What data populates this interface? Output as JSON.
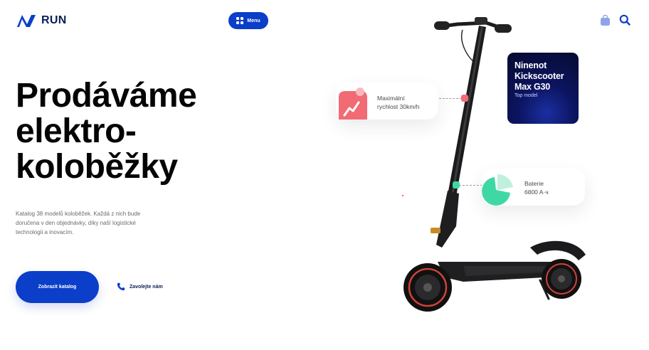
{
  "brand": {
    "name": "RUN",
    "color": "#0b3ec9"
  },
  "header": {
    "menu_label": "Menu",
    "icons": [
      "shopping-bag-icon",
      "search-icon"
    ]
  },
  "hero": {
    "title_lines": [
      "Prodáváme",
      "elektro-",
      "koloběžky"
    ],
    "description": "Katalog 38 modelů koloběžek. Každá z nich bude doručena v den objednávky, díky naší logistické technologii a inovacím.",
    "cta_label": "Zobrazit katalog",
    "call_label": "Zavolejte nám"
  },
  "features": {
    "speed": {
      "line1": "Maximální",
      "line2": "rychlost 30km/h",
      "color": "#f26a73"
    },
    "battery": {
      "line1": "Baterie",
      "line2": "6800 A·ч",
      "color": "#3fd8a5"
    }
  },
  "model": {
    "name": "Ninenot Kickscooter Max G30",
    "subtitle": "Top model"
  }
}
